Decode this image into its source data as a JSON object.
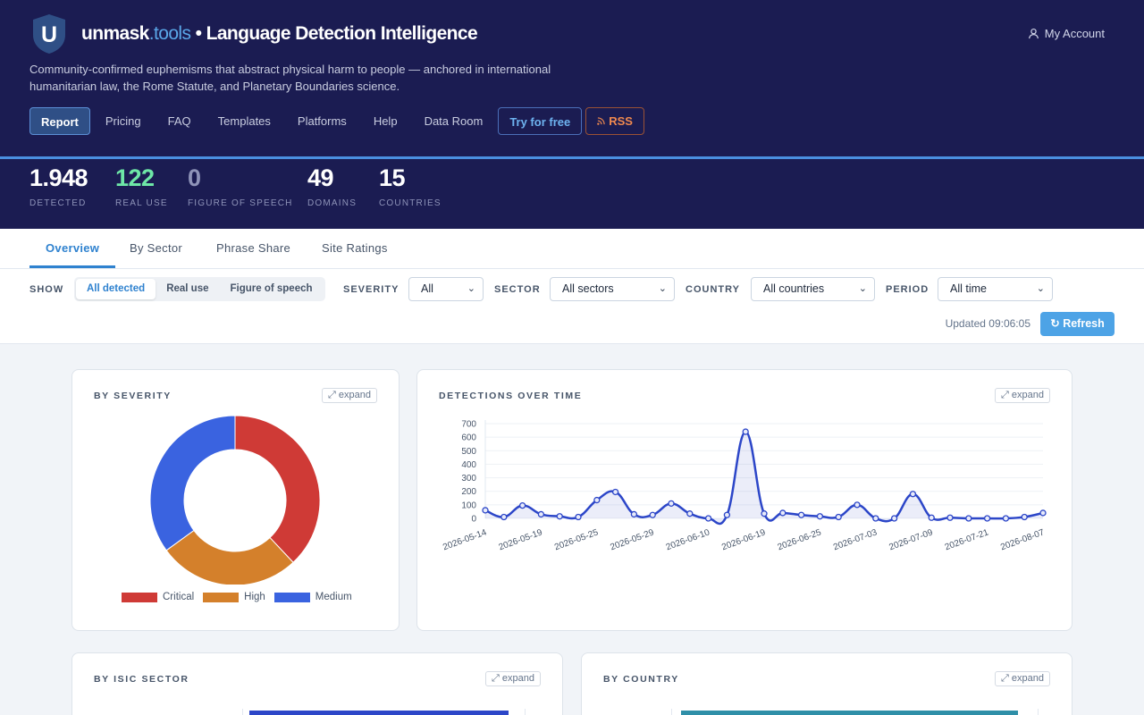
{
  "brand": {
    "name": "unmask",
    "tld": ".tools",
    "subtitle": "• Language Detection Intelligence",
    "logo_letter": "U"
  },
  "account": {
    "label": "My Account",
    "icon": "user-icon"
  },
  "tagline": "Community-confirmed euphemisms that abstract physical harm to people — anchored in international humanitarian law, the Rome Statute, and Planetary Boundaries science.",
  "nav": {
    "items": [
      "Report",
      "Pricing",
      "FAQ",
      "Templates",
      "Platforms",
      "Help",
      "Data Room"
    ],
    "try_label": "Try for free",
    "rss_label": "RSS"
  },
  "stats": [
    {
      "value": "1.948",
      "label": "DETECTED",
      "color": "#ffffff"
    },
    {
      "value": "122",
      "label": "REAL USE",
      "color": "#6ee7a7"
    },
    {
      "value": "0",
      "label": "FIGURE OF SPEECH",
      "color": "#8e93b8"
    },
    {
      "value": "49",
      "label": "DOMAINS",
      "color": "#ffffff"
    },
    {
      "value": "15",
      "label": "COUNTRIES",
      "color": "#ffffff"
    }
  ],
  "tabs": [
    "Overview",
    "By Sector",
    "Phrase Share",
    "Site Ratings"
  ],
  "filters": {
    "show_label": "SHOW",
    "show_options": [
      "All detected",
      "Real use",
      "Figure of speech"
    ],
    "severity_label": "SEVERITY",
    "severity_value": "All",
    "sector_label": "SECTOR",
    "sector_value": "All sectors",
    "country_label": "COUNTRY",
    "country_value": "All countries",
    "period_label": "PERIOD",
    "period_value": "All time",
    "updated": "Updated 09:06:05",
    "refresh_label": "↻ Refresh"
  },
  "cards": {
    "severity_title": "BY SEVERITY",
    "time_title": "DETECTIONS OVER TIME",
    "sector_title": "BY ISIC SECTOR",
    "country_title": "BY COUNTRY",
    "expand_label": "⤢ expand"
  },
  "colors": {
    "critical": "#cf3a36",
    "high": "#d4802b",
    "medium": "#3a63e0",
    "line": "#2c46c8"
  },
  "chart_data": [
    {
      "type": "pie",
      "labels": [
        "Critical",
        "High",
        "Medium"
      ],
      "values": [
        38,
        27,
        35
      ]
    },
    {
      "type": "line",
      "ylim": [
        0,
        700
      ],
      "yticks": [
        0,
        100,
        200,
        300,
        400,
        500,
        600,
        700
      ],
      "xtick_labels": [
        "2026-05-14",
        "2026-05-19",
        "2026-05-25",
        "2026-05-29",
        "2026-06-10",
        "2026-06-19",
        "2026-06-25",
        "2026-07-03",
        "2026-07-09",
        "2026-07-21",
        "2026-08-07"
      ],
      "values": [
        60,
        10,
        95,
        30,
        15,
        10,
        135,
        195,
        30,
        25,
        110,
        35,
        0,
        25,
        640,
        35,
        40,
        25,
        15,
        10,
        100,
        0,
        0,
        180,
        5,
        5,
        0,
        0,
        0,
        10,
        40
      ]
    }
  ]
}
